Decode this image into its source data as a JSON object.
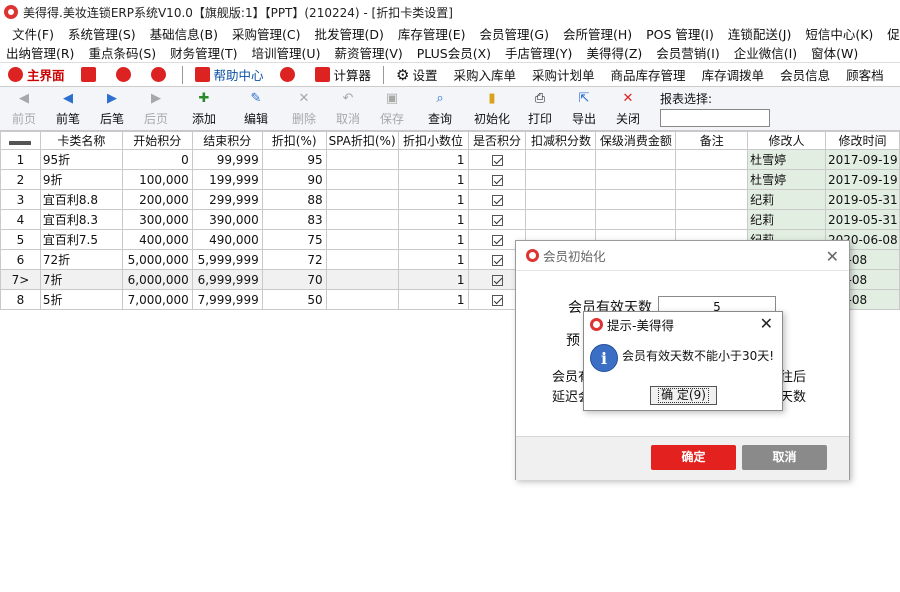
{
  "window": {
    "title": "美得得.美妆连锁ERP系统V10.0【旗舰版:1】【PPT】(210224) - [折扣卡类设置]"
  },
  "menu": {
    "row1": [
      "文件(F)",
      "系统管理(S)",
      "基础信息(B)",
      "采购管理(C)",
      "批发管理(D)",
      "库存管理(E)",
      "会员管理(G)",
      "会所管理(H)",
      "POS 管理(I)",
      "连锁配送(J)",
      "短信中心(K)",
      "促销管理"
    ],
    "row2": [
      "出纳管理(R)",
      "重点条码(S)",
      "财务管理(T)",
      "培训管理(U)",
      "薪资管理(V)",
      "PLUS会员(X)",
      "手店管理(Y)",
      "美得得(Z)",
      "会员营销(I)",
      "企业微信(I)",
      "窗体(W)"
    ]
  },
  "quick": {
    "main": "主界面",
    "help": "帮助中心",
    "calculator": "计算器",
    "settings": "设置",
    "items": [
      "采购入库单",
      "采购计划单",
      "商品库存管理",
      "库存调拨单",
      "会员信息",
      "顾客档"
    ]
  },
  "toolbar": {
    "first": "前页",
    "prev": "前笔",
    "next": "后笔",
    "last": "后页",
    "add": "添加",
    "edit": "编辑",
    "delete": "删除",
    "cancel": "取消",
    "save": "保存",
    "query": "查询",
    "init": "初始化",
    "print": "打印",
    "export": "导出",
    "close": "关闭",
    "report_label": "报表选择:"
  },
  "table": {
    "headers": [
      "卡类名称",
      "开始积分",
      "结束积分",
      "折扣(%)",
      "SPA折扣(%)",
      "折扣小数位",
      "是否积分",
      "扣减积分数",
      "保级消费金额",
      "备注",
      "修改人",
      "修改时间"
    ],
    "rows": [
      {
        "num": "1",
        "name": "95折",
        "start": "0",
        "end": "99,999",
        "discount": "95",
        "decimal": "1",
        "modifier": "杜雪婷",
        "time": "2017-09-19"
      },
      {
        "num": "2",
        "name": "9折",
        "start": "100,000",
        "end": "199,999",
        "discount": "90",
        "decimal": "1",
        "modifier": "杜雪婷",
        "time": "2017-09-19"
      },
      {
        "num": "3",
        "name": "宜百利8.8",
        "start": "200,000",
        "end": "299,999",
        "discount": "88",
        "decimal": "1",
        "modifier": "纪莉",
        "time": "2019-05-31"
      },
      {
        "num": "4",
        "name": "宜百利8.3",
        "start": "300,000",
        "end": "390,000",
        "discount": "83",
        "decimal": "1",
        "modifier": "纪莉",
        "time": "2019-05-31"
      },
      {
        "num": "5",
        "name": "宜百利7.5",
        "start": "400,000",
        "end": "490,000",
        "discount": "75",
        "decimal": "1",
        "modifier": "纪莉",
        "time": "2020-06-08"
      },
      {
        "num": "6",
        "name": "72折",
        "start": "5,000,000",
        "end": "5,999,999",
        "discount": "72",
        "decimal": "1",
        "modifier": "",
        "time": "-06-08"
      },
      {
        "num": "7>",
        "name": "7折",
        "start": "6,000,000",
        "end": "6,999,999",
        "discount": "70",
        "decimal": "1",
        "modifier": "",
        "time": "-06-08"
      },
      {
        "num": "8",
        "name": "5折",
        "start": "7,000,000",
        "end": "7,999,999",
        "discount": "50",
        "decimal": "1",
        "modifier": "",
        "time": "-06-08"
      }
    ]
  },
  "init_dialog": {
    "title": "会员初始化",
    "valid_days_label": "会员有效天数",
    "valid_days_value": "5",
    "frag_pre": "预",
    "frag_member": "会员有",
    "frag_delay": "延迟会",
    "frag_after": "往后",
    "frag_days": "天数",
    "confirm": "确定",
    "cancel": "取消"
  },
  "alert": {
    "title": "提示-美得得",
    "message": "会员有效天数不能小于30天!",
    "ok": "确 定(9)"
  }
}
